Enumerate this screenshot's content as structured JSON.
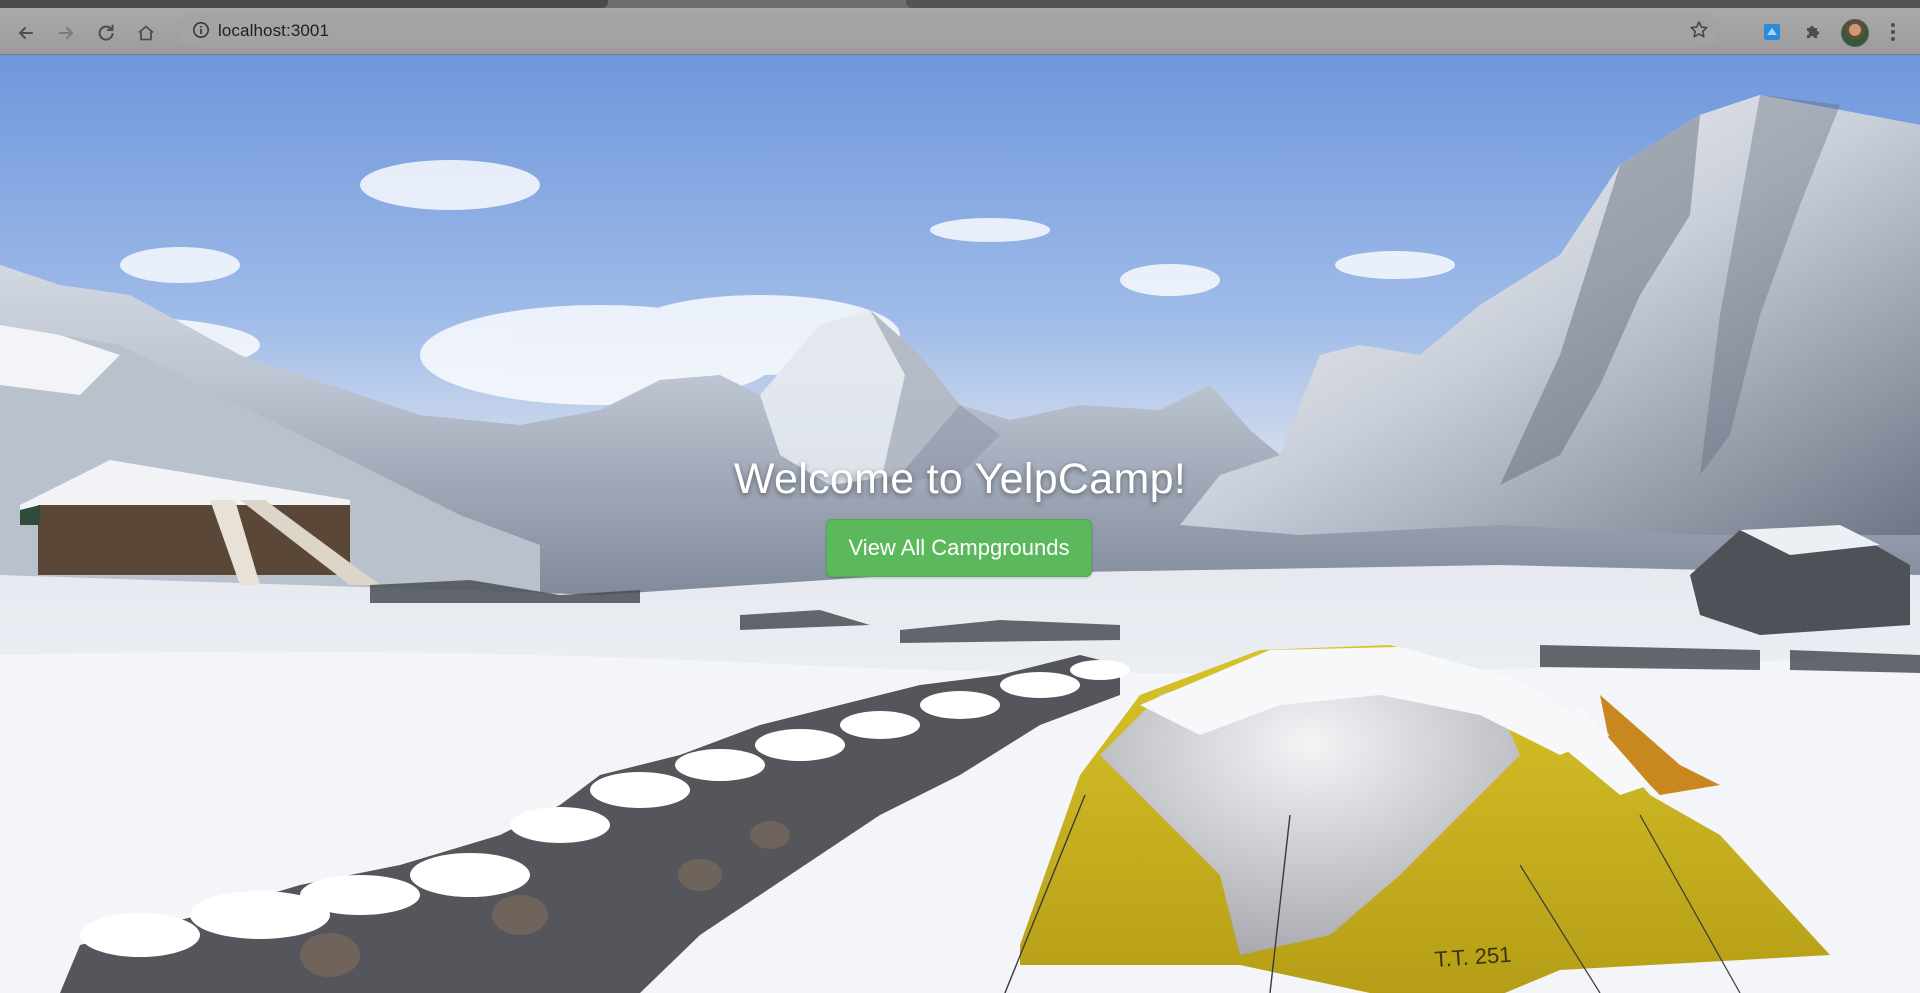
{
  "browser": {
    "url": "localhost:3001",
    "icons": {
      "back": "back-arrow-icon",
      "forward": "forward-arrow-icon",
      "reload": "reload-icon",
      "home": "home-icon",
      "site_info": "info-icon",
      "bookmark": "star-icon",
      "extension": "extension-icon",
      "extensions_menu": "puzzle-icon",
      "profile": "avatar",
      "menu": "kebab-menu-icon"
    }
  },
  "landing": {
    "title": "Welcome to YelpCamp!",
    "button_label": "View All Campgrounds",
    "button_color": "#5cb85c",
    "title_color": "#ffffff"
  }
}
